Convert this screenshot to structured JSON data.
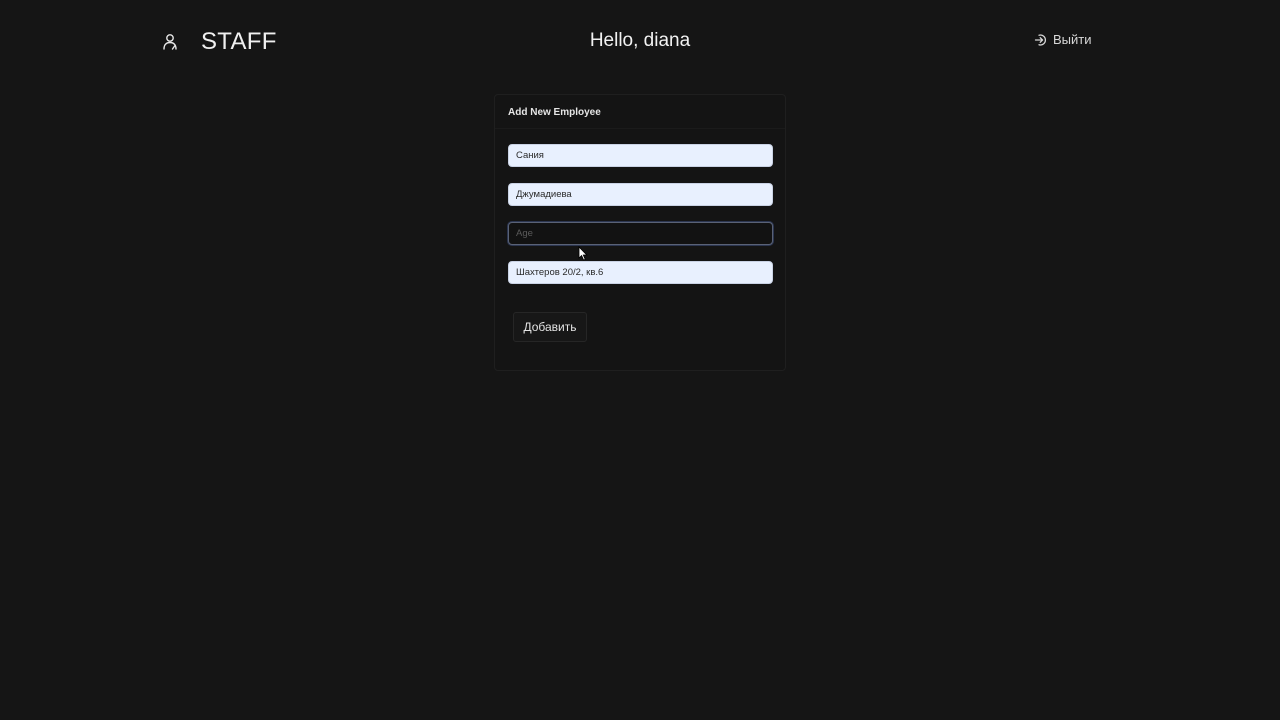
{
  "header": {
    "brand": "STAFF",
    "greeting": "Hello, diana",
    "logout_label": "Выйти",
    "logo_icon": "user-profile-icon",
    "logout_icon": "logout-icon"
  },
  "form": {
    "title": "Add New Employee",
    "fields": {
      "first_name": {
        "value": "Сания",
        "placeholder": ""
      },
      "last_name": {
        "value": "Джумадиева",
        "placeholder": ""
      },
      "age": {
        "value": "",
        "placeholder": "Age"
      },
      "address": {
        "value": "Шахтеров 20/2, кв.6",
        "placeholder": ""
      }
    },
    "submit_label": "Добавить"
  },
  "colors": {
    "background": "#151515",
    "autofill_field": "#e8f0fe",
    "text": "#f0f0f0"
  }
}
